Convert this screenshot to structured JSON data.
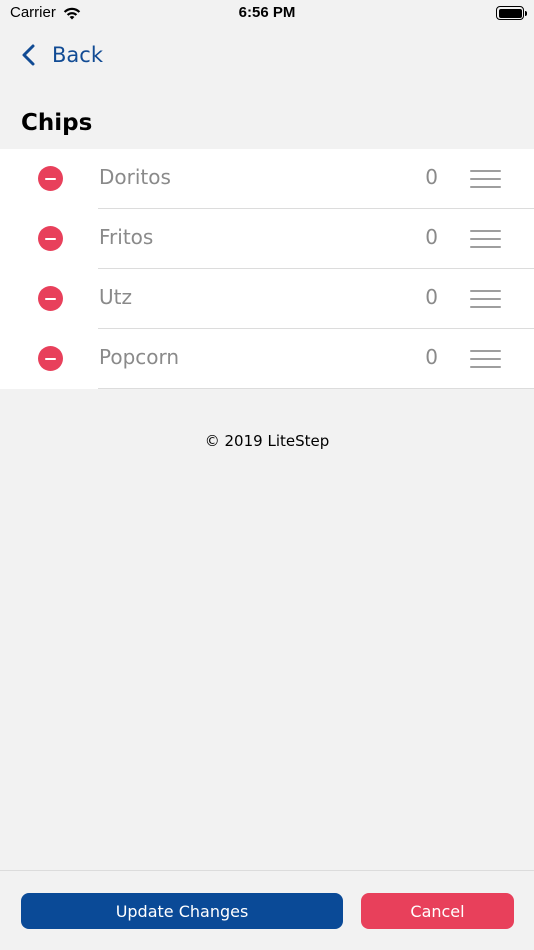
{
  "status_bar": {
    "carrier": "Carrier",
    "time": "6:56 PM"
  },
  "nav": {
    "back_label": "Back"
  },
  "section": {
    "title": "Chips"
  },
  "items": [
    {
      "name": "Doritos",
      "count": "0"
    },
    {
      "name": "Fritos",
      "count": "0"
    },
    {
      "name": "Utz",
      "count": "0"
    },
    {
      "name": "Popcorn",
      "count": "0"
    }
  ],
  "footer_text": "© 2019 LiteStep",
  "actions": {
    "update_label": "Update Changes",
    "cancel_label": "Cancel"
  },
  "colors": {
    "accent_blue": "#0a4a97",
    "delete_red": "#e8405b"
  }
}
